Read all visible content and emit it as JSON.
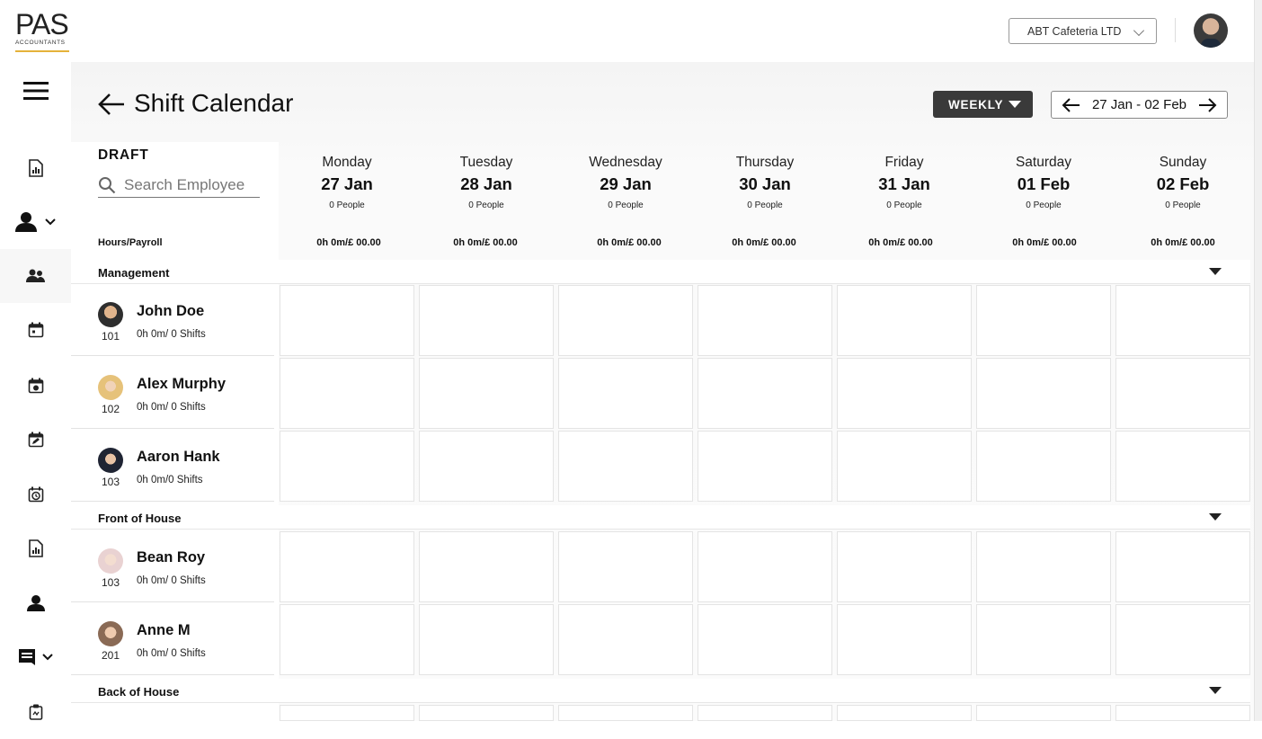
{
  "logo": {
    "line1": "PAS",
    "line2": "ACCOUNTANTS",
    "accent": "#e5b23a"
  },
  "topbar": {
    "company": "ABT Cafeteria LTD"
  },
  "sidebar": {
    "items": [
      {
        "name": "menu-icon"
      },
      {
        "name": "report-icon"
      },
      {
        "name": "user-icon"
      },
      {
        "name": "team-icon"
      },
      {
        "name": "calendar-icon"
      },
      {
        "name": "calendar-check-icon"
      },
      {
        "name": "calendar-edit-icon"
      },
      {
        "name": "clock-calendar-icon"
      },
      {
        "name": "report-icon"
      },
      {
        "name": "user-icon"
      },
      {
        "name": "receipt-icon"
      },
      {
        "name": "clipboard-icon"
      }
    ]
  },
  "header": {
    "title": "Shift Calendar",
    "view": "WEEKLY",
    "range": "27 Jan - 02 Feb"
  },
  "panel": {
    "draft": "DRAFT",
    "search_placeholder": "Search Employee",
    "hours_label": "Hours/Payroll"
  },
  "days": [
    {
      "name": "Monday",
      "date": "27 Jan",
      "people": "0 People",
      "hours": "0h 0m/£ 00.00"
    },
    {
      "name": "Tuesday",
      "date": "28 Jan",
      "people": "0 People",
      "hours": "0h 0m/£ 00.00"
    },
    {
      "name": "Wednesday",
      "date": "29 Jan",
      "people": "0 People",
      "hours": "0h 0m/£ 00.00"
    },
    {
      "name": "Thursday",
      "date": "30 Jan",
      "people": "0 People",
      "hours": "0h 0m/£ 00.00"
    },
    {
      "name": "Friday",
      "date": "31 Jan",
      "people": "0 People",
      "hours": "0h 0m/£ 00.00"
    },
    {
      "name": "Saturday",
      "date": "01 Feb",
      "people": "0 People",
      "hours": "0h 0m/£ 00.00"
    },
    {
      "name": "Sunday",
      "date": "02 Feb",
      "people": "0 People",
      "hours": "0h 0m/£ 00.00"
    }
  ],
  "groups": [
    {
      "label": "Management"
    },
    {
      "label": "Front of House"
    },
    {
      "label": "Back of House"
    }
  ],
  "employees": [
    {
      "name": "John Doe",
      "id": "101",
      "shifts": "0h 0m/ 0 Shifts"
    },
    {
      "name": "Alex Murphy",
      "id": "102",
      "shifts": "0h 0m/ 0 Shifts"
    },
    {
      "name": "Aaron Hank",
      "id": "103",
      "shifts": "0h 0m/0 Shifts"
    },
    {
      "name": "Bean Roy",
      "id": "103",
      "shifts": "0h 0m/ 0 Shifts"
    },
    {
      "name": "Anne M",
      "id": "201",
      "shifts": "0h 0m/ 0 Shifts"
    }
  ]
}
